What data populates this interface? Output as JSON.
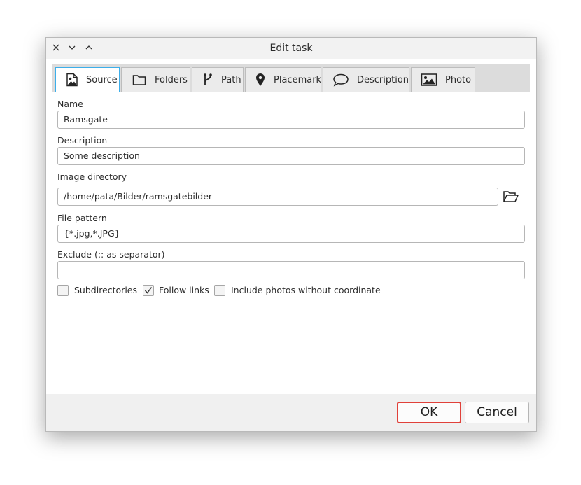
{
  "window": {
    "title": "Edit task"
  },
  "tabs": [
    {
      "label": "Source",
      "icon": "image-file-icon",
      "active": true
    },
    {
      "label": "Folders",
      "icon": "folder-icon",
      "active": false
    },
    {
      "label": "Path",
      "icon": "path-fork-icon",
      "active": false
    },
    {
      "label": "Placemark",
      "icon": "placemark-pin-icon",
      "active": false
    },
    {
      "label": "Description",
      "icon": "speech-bubble-icon",
      "active": false
    },
    {
      "label": "Photo",
      "icon": "photo-icon",
      "active": false
    }
  ],
  "form": {
    "name_label": "Name",
    "name_value": "Ramsgate",
    "description_label": "Description",
    "description_value": "Some description",
    "image_dir_label": "Image directory",
    "image_dir_value": "/home/pata/Bilder/ramsgatebilder",
    "file_pattern_label": "File pattern",
    "file_pattern_value": "{*.jpg,*.JPG}",
    "exclude_label": "Exclude (:: as separator)",
    "exclude_value": ""
  },
  "options": {
    "subdirectories_label": "Subdirectories",
    "subdirectories_checked": false,
    "follow_links_label": "Follow links",
    "follow_links_checked": true,
    "include_no_coord_label": "Include photos without coordinate",
    "include_no_coord_checked": false
  },
  "buttons": {
    "ok_label": "OK",
    "cancel_label": "Cancel"
  },
  "colors": {
    "accent_tab": "#3daee9",
    "default_button_border": "#e0413a"
  }
}
